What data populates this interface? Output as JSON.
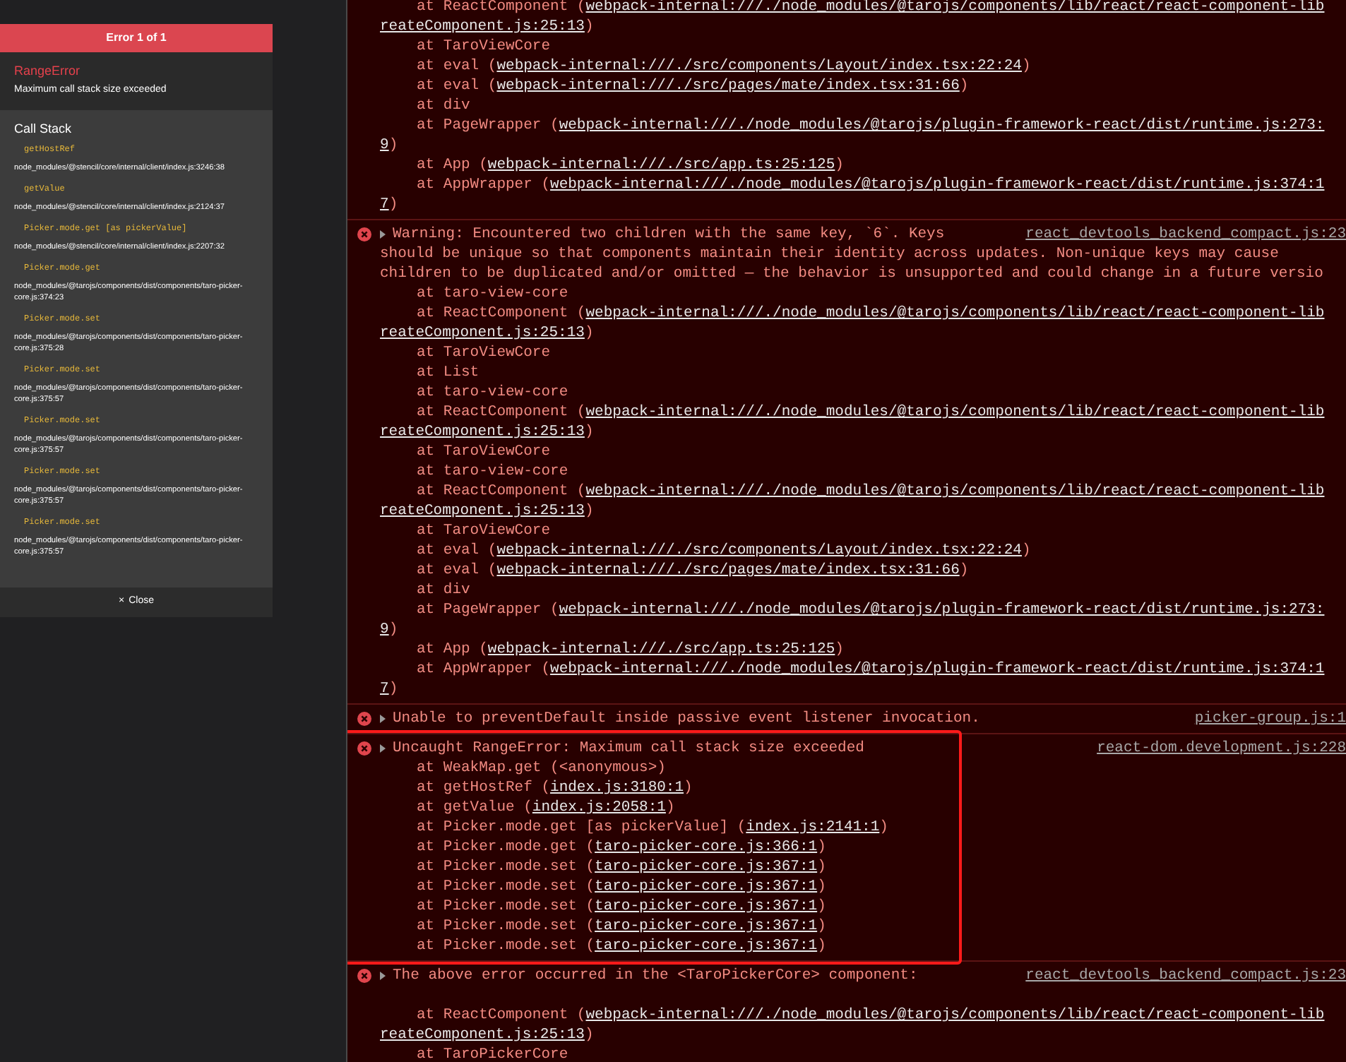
{
  "overlay": {
    "header": "Error 1 of 1",
    "error_name": "RangeError",
    "error_message": "Maximum call stack size exceeded",
    "call_stack_title": "Call Stack",
    "stack": [
      {
        "fn": "getHostRef",
        "file": "node_modules/@stencil/core/internal/client/index.js:3246:38"
      },
      {
        "fn": "getValue",
        "file": "node_modules/@stencil/core/internal/client/index.js:2124:37"
      },
      {
        "fn": "Picker.mode.get [as pickerValue]",
        "file": "node_modules/@stencil/core/internal/client/index.js:2207:32"
      },
      {
        "fn": "Picker.mode.get",
        "file": "node_modules/@tarojs/components/dist/components/taro-picker-core.js:374:23"
      },
      {
        "fn": "Picker.mode.set",
        "file": "node_modules/@tarojs/components/dist/components/taro-picker-core.js:375:28"
      },
      {
        "fn": "Picker.mode.set",
        "file": "node_modules/@tarojs/components/dist/components/taro-picker-core.js:375:57"
      },
      {
        "fn": "Picker.mode.set",
        "file": "node_modules/@tarojs/components/dist/components/taro-picker-core.js:375:57"
      },
      {
        "fn": "Picker.mode.set",
        "file": "node_modules/@tarojs/components/dist/components/taro-picker-core.js:375:57"
      },
      {
        "fn": "Picker.mode.set",
        "file": "node_modules/@tarojs/components/dist/components/taro-picker-core.js:375:57"
      }
    ],
    "close_icon": "×",
    "close_label": "Close"
  },
  "console": {
    "messages": [
      {
        "kind": "continuation",
        "frames": [
          {
            "text": "at ReactComponent (",
            "link": "webpack-internal:///./node_modules/@tarojs/components/lib/react/react-component-lib",
            "wrap": "reateComponent.js:25:13",
            "after": ")"
          },
          {
            "text": "at TaroViewCore"
          },
          {
            "text": "at eval (",
            "link": "webpack-internal:///./src/components/Layout/index.tsx:22:24",
            "after": ")"
          },
          {
            "text": "at eval (",
            "link": "webpack-internal:///./src/pages/mate/index.tsx:31:66",
            "after": ")"
          },
          {
            "text": "at div"
          },
          {
            "text": "at PageWrapper (",
            "link": "webpack-internal:///./node_modules/@tarojs/plugin-framework-react/dist/runtime.js:273:",
            "wrap": "9",
            "after": ")"
          },
          {
            "text": "at App (",
            "link": "webpack-internal:///./src/app.ts:25:125",
            "after": ")"
          },
          {
            "text": "at AppWrapper (",
            "link": "webpack-internal:///./node_modules/@tarojs/plugin-framework-react/dist/runtime.js:374:1",
            "wrap": "7",
            "after": ")"
          }
        ]
      },
      {
        "kind": "error",
        "lines": [
          "Warning: Encountered two children with the same key, `6`. Keys",
          "should be unique so that components maintain their identity across updates. Non-unique keys may cause",
          "children to be duplicated and/or omitted — the behavior is unsupported and could change in a future versio"
        ],
        "source": "react_devtools_backend_compact.js:23",
        "frames": [
          {
            "text": "at taro-view-core"
          },
          {
            "text": "at ReactComponent (",
            "link": "webpack-internal:///./node_modules/@tarojs/components/lib/react/react-component-lib",
            "wrap": "reateComponent.js:25:13",
            "after": ")"
          },
          {
            "text": "at TaroViewCore"
          },
          {
            "text": "at List"
          },
          {
            "text": "at taro-view-core"
          },
          {
            "text": "at ReactComponent (",
            "link": "webpack-internal:///./node_modules/@tarojs/components/lib/react/react-component-lib",
            "wrap": "reateComponent.js:25:13",
            "after": ")"
          },
          {
            "text": "at TaroViewCore"
          },
          {
            "text": "at taro-view-core"
          },
          {
            "text": "at ReactComponent (",
            "link": "webpack-internal:///./node_modules/@tarojs/components/lib/react/react-component-lib",
            "wrap": "reateComponent.js:25:13",
            "after": ")"
          },
          {
            "text": "at TaroViewCore"
          },
          {
            "text": "at eval (",
            "link": "webpack-internal:///./src/components/Layout/index.tsx:22:24",
            "after": ")"
          },
          {
            "text": "at eval (",
            "link": "webpack-internal:///./src/pages/mate/index.tsx:31:66",
            "after": ")"
          },
          {
            "text": "at div"
          },
          {
            "text": "at PageWrapper (",
            "link": "webpack-internal:///./node_modules/@tarojs/plugin-framework-react/dist/runtime.js:273:",
            "wrap": "9",
            "after": ")"
          },
          {
            "text": "at App (",
            "link": "webpack-internal:///./src/app.ts:25:125",
            "after": ")"
          },
          {
            "text": "at AppWrapper (",
            "link": "webpack-internal:///./node_modules/@tarojs/plugin-framework-react/dist/runtime.js:374:1",
            "wrap": "7",
            "after": ")"
          }
        ]
      },
      {
        "kind": "error",
        "lines": [
          "Unable to preventDefault inside passive event listener invocation."
        ],
        "source": "picker-group.js:1"
      },
      {
        "kind": "error",
        "lines": [
          "Uncaught RangeError: Maximum call stack size exceeded"
        ],
        "source": "react-dom.development.js:228",
        "highlighted": true,
        "frames": [
          {
            "text": "at WeakMap.get (<anonymous>)"
          },
          {
            "text": "at getHostRef (",
            "link": "index.js:3180:1",
            "after": ")"
          },
          {
            "text": "at getValue (",
            "link": "index.js:2058:1",
            "after": ")"
          },
          {
            "text": "at Picker.mode.get [as pickerValue] (",
            "link": "index.js:2141:1",
            "after": ")"
          },
          {
            "text": "at Picker.mode.get (",
            "link": "taro-picker-core.js:366:1",
            "after": ")"
          },
          {
            "text": "at Picker.mode.set (",
            "link": "taro-picker-core.js:367:1",
            "after": ")"
          },
          {
            "text": "at Picker.mode.set (",
            "link": "taro-picker-core.js:367:1",
            "after": ")"
          },
          {
            "text": "at Picker.mode.set (",
            "link": "taro-picker-core.js:367:1",
            "after": ")"
          },
          {
            "text": "at Picker.mode.set (",
            "link": "taro-picker-core.js:367:1",
            "after": ")"
          },
          {
            "text": "at Picker.mode.set (",
            "link": "taro-picker-core.js:367:1",
            "after": ")"
          }
        ]
      },
      {
        "kind": "error",
        "lines": [
          "The above error occurred in the <TaroPickerCore> component:"
        ],
        "source": "react_devtools_backend_compact.js:23",
        "blank_line": true,
        "frames": [
          {
            "text": "at ReactComponent (",
            "link": "webpack-internal:///./node_modules/@tarojs/components/lib/react/react-component-lib",
            "wrap": "reateComponent.js:25:13",
            "after": ")"
          },
          {
            "text": "at TaroPickerCore"
          }
        ]
      }
    ]
  }
}
